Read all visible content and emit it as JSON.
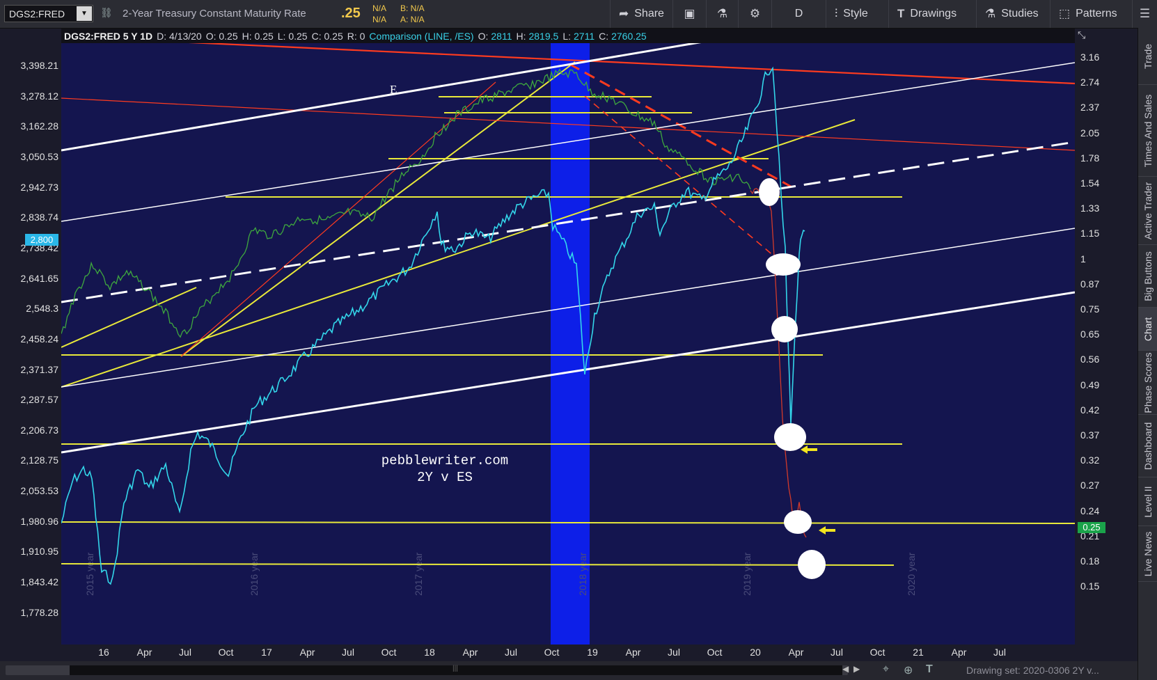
{
  "toolbar": {
    "symbol": "DGS2:FRED",
    "description": "2-Year Treasury Constant Maturity Rate",
    "last": ".25",
    "na1": "N/A",
    "na2": "N/A",
    "bid": "B: N/A",
    "ask": "A: N/A",
    "buttons": {
      "share": "Share",
      "period": "D",
      "style": "Style",
      "drawings": "Drawings",
      "studies": "Studies",
      "patterns": "Patterns"
    }
  },
  "info_bar": {
    "title": "DGS2:FRED 5 Y 1D",
    "date": "D: 4/13/20",
    "open": "O: 0.25",
    "high": "H: 0.25",
    "low": "L: 0.25",
    "close": "C: 0.25",
    "range": "R: 0",
    "comparison": "Comparison (LINE, /ES)",
    "cmp_open_label": "O:",
    "cmp_open": "2811",
    "cmp_high_label": "H:",
    "cmp_high": "2819.5",
    "cmp_low_label": "L:",
    "cmp_low": "2711",
    "cmp_close_label": "C:",
    "cmp_close": "2760.25"
  },
  "left_axis": {
    "ticks": [
      "3,398.21",
      "3,278.12",
      "3,162.28",
      "3,050.53",
      "2,942.73",
      "2,838.74",
      "2,738.42",
      "2,641.65",
      "2,548.3",
      "2,458.24",
      "2,371.37",
      "2,287.57",
      "2,206.73",
      "2,128.75",
      "2,053.53",
      "1,980.96",
      "1,910.95",
      "1,843.42",
      "1,778.28"
    ],
    "badge": "2,800"
  },
  "right_axis": {
    "ticks": [
      "3.16",
      "2.74",
      "2.37",
      "2.05",
      "1.78",
      "1.54",
      "1.33",
      "1.15",
      "1",
      "0.87",
      "0.75",
      "0.65",
      "0.56",
      "0.49",
      "0.42",
      "0.37",
      "0.32",
      "0.27",
      "0.24",
      "0.21",
      "0.18",
      "0.15"
    ],
    "badge": "0.25"
  },
  "x_axis": {
    "ticks": [
      "16",
      "Apr",
      "Jul",
      "Oct",
      "17",
      "Apr",
      "Jul",
      "Oct",
      "18",
      "Apr",
      "Jul",
      "Oct",
      "19",
      "Apr",
      "Jul",
      "Oct",
      "20",
      "Apr",
      "Jul",
      "Oct",
      "21",
      "Apr",
      "Jul"
    ]
  },
  "year_watermarks": [
    "2015 year",
    "2016 year",
    "2017 year",
    "2018 year",
    "2019 year",
    "2020 year"
  ],
  "annotations": {
    "site": "pebblewriter.com",
    "subtitle": "2Y v ES",
    "letter_e": "E"
  },
  "status": {
    "drawing_set": "Drawing set: 2020-0306 2Y v..."
  },
  "side_tabs": [
    "Trade",
    "Times And Sales",
    "Active Trader",
    "Big Buttons",
    "Chart",
    "Phase Scores",
    "Dashboard",
    "Level II",
    "Live News"
  ],
  "colors": {
    "plot_bg": "#14154f",
    "highlight_band": "#0d1fe8",
    "es_line": "#33d6ea",
    "yield_up": "#3ea83e",
    "yield_down": "#d23a2a",
    "trendline_white": "#ffffff",
    "trendline_yellow": "#e9e93a",
    "trendline_red": "#ff3b1f"
  }
}
